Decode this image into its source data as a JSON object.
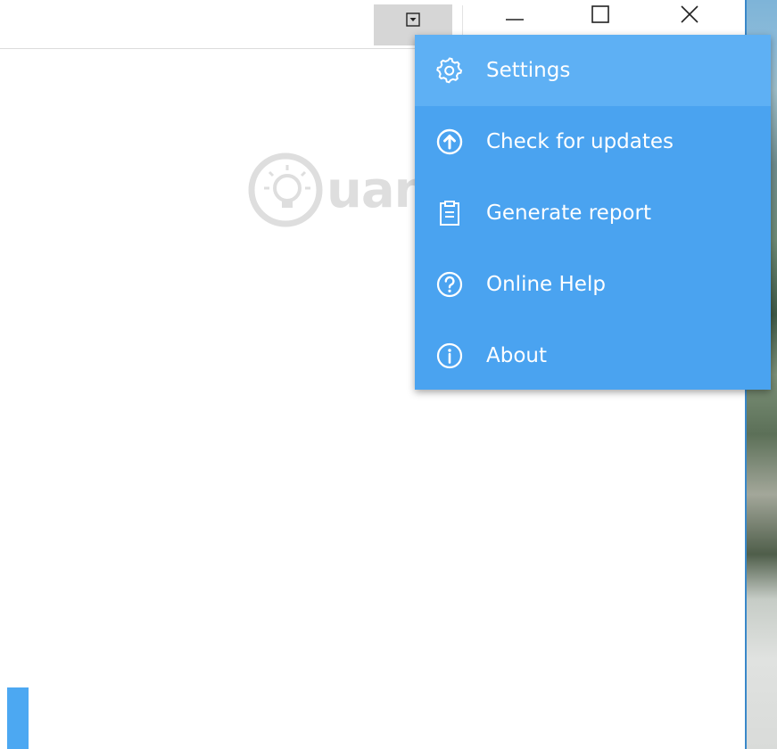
{
  "title_bar": {
    "menu_toggle_icon": "dropdown-arrow-icon",
    "window_controls": [
      "minimize-icon",
      "maximize-icon",
      "close-icon"
    ]
  },
  "watermark": {
    "text": "uantrimang",
    "icon": "lightbulb-icon"
  },
  "dropdown_menu": {
    "items": [
      {
        "label": "Settings",
        "icon": "gear-icon",
        "highlighted": true
      },
      {
        "label": "Check for updates",
        "icon": "upload-arrow-icon"
      },
      {
        "label": "Generate report",
        "icon": "report-icon"
      },
      {
        "label": "Online Help",
        "icon": "help-icon"
      },
      {
        "label": "About",
        "icon": "info-icon"
      }
    ]
  },
  "colors": {
    "menu_background": "#4aa3f0",
    "menu_highlight": "#5eb0f4",
    "menu_text": "#ffffff",
    "toggle_background": "#d6d6d6",
    "accent": "#4ca8f2"
  }
}
